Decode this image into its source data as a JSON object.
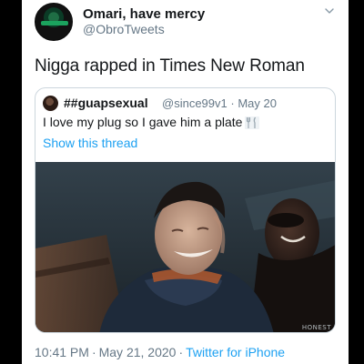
{
  "author": {
    "display_name": "Omari, have mercy",
    "handle": "@ObroTweets"
  },
  "tweet": {
    "text": "Nigga rapped in Times New Roman"
  },
  "quoted_tweet": {
    "display_name": "##guapsexual",
    "handle": "@since99v1",
    "date": "May 20",
    "text": "I love my plug so I gave him a plate",
    "emoji": "fork-and-knife-icon",
    "show_thread_label": "Show this thread",
    "media_watermark": "HONEST"
  },
  "footer": {
    "time": "10:41 PM",
    "date": "May 21, 2020",
    "source": "Twitter for iPhone",
    "separator": "·"
  },
  "colors": {
    "text_primary": "#14171a",
    "text_secondary": "#657786",
    "link": "#1da1f2",
    "border": "#ccd6dd"
  }
}
